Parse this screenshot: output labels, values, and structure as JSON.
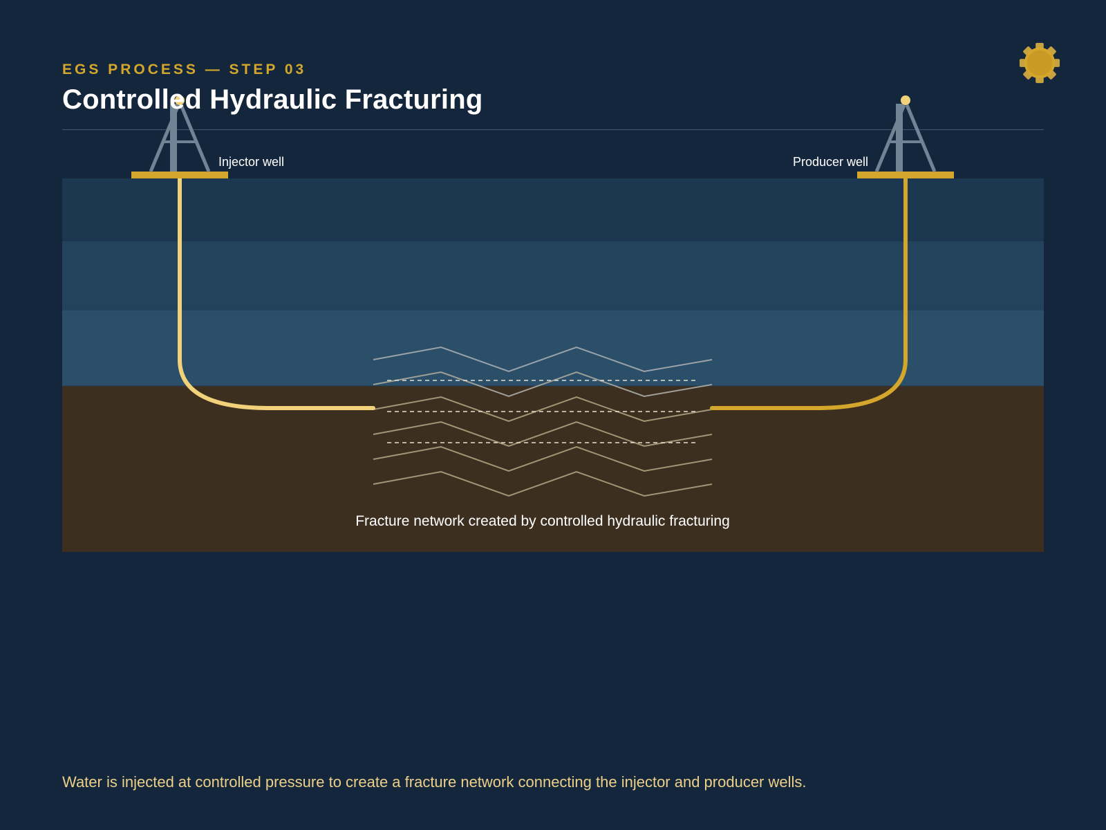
{
  "header": {
    "step_label": "EGS PROCESS — STEP 03",
    "title": "Controlled Hydraulic Fracturing"
  },
  "diagram": {
    "injector_label": "Injector well",
    "producer_label": "Producer well",
    "fracture_label": "Fracture network created by controlled hydraulic fracturing",
    "colors": {
      "background": "#13263b",
      "layer_1": "#1c3850",
      "layer_2": "#22435b",
      "layer_3": "#2b4f68",
      "hot_rock": "#3d2f1f",
      "injector_pipe": "#f1d27a",
      "producer_pipe": "#d4a72c",
      "rig": "#6f8494",
      "rig_base": "#d4a72c",
      "fracture_line": "#a39676",
      "fracture_dash": "#e6e0cf"
    }
  },
  "footer": {
    "caption": "Water is injected at controlled pressure to create a fracture network connecting the injector and producer wells."
  },
  "icons": {
    "corner_icon": "gear-icon"
  }
}
